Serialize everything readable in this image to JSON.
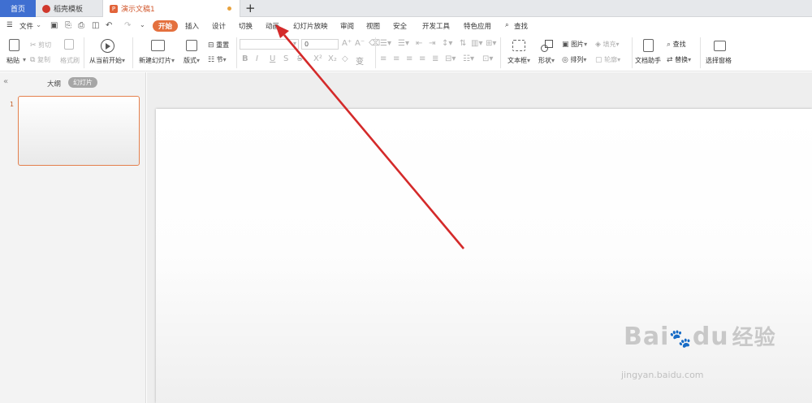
{
  "tabs": {
    "home": "首页",
    "templates": "稻壳模板",
    "document": "演示文稿1",
    "doc_icon": "P"
  },
  "menu": {
    "file": "文件",
    "items": [
      "开始",
      "插入",
      "设计",
      "切换",
      "动画",
      "幻灯片放映",
      "审阅",
      "视图",
      "安全",
      "开发工具",
      "特色应用"
    ],
    "search": "查找"
  },
  "ribbon": {
    "paste": "粘贴",
    "cut": "剪切",
    "copy": "复制",
    "format_painter": "格式刷",
    "play_from_current": "从当前开始",
    "new_slide": "新建幻灯片",
    "layout": "版式",
    "reset": "重置",
    "section": "节",
    "font_size": "0",
    "textbox": "文本框",
    "shape": "形状",
    "picture": "图片",
    "fill": "填充",
    "arrange": "排列",
    "outline": "轮廓",
    "doc_assistant": "文档助手",
    "find": "查找",
    "replace": "替换",
    "selection_pane": "选择窗格"
  },
  "left_pane": {
    "outline_label": "大纲",
    "slides_label": "幻灯片",
    "slide_number": "1"
  },
  "annotation": {
    "arrow_color": "#d42a2a"
  },
  "watermark": {
    "brand": "Bai",
    "brand2": "du",
    "suffix": "经验",
    "url": "jingyan.baidu.com"
  },
  "colors": {
    "accent": "#e4703e",
    "home_tab": "#3f6fd1"
  }
}
